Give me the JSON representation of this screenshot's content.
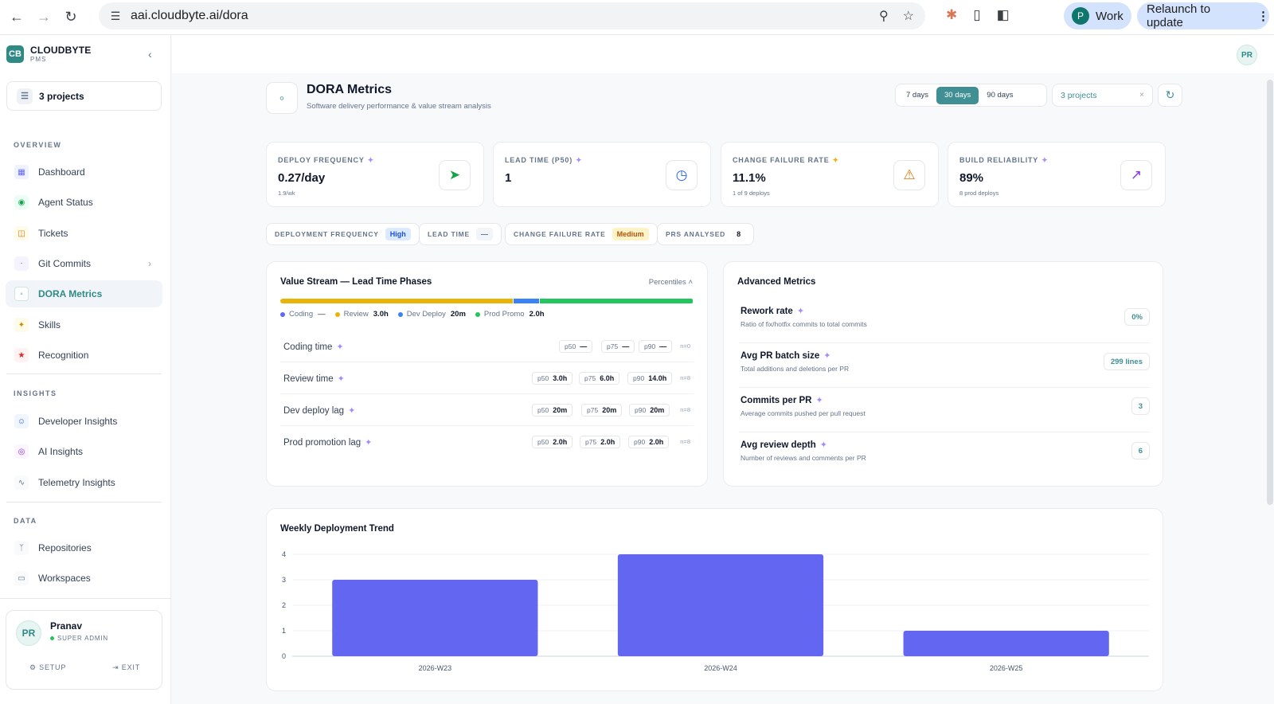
{
  "browser": {
    "url": "aai.cloudbyte.ai/dora",
    "profile_initial": "P",
    "profile_label": "Work",
    "relaunch_label": "Relaunch to update"
  },
  "sidebar": {
    "brand_name": "CLOUDBYTE",
    "brand_sub": "PMS",
    "logo_text": "CB",
    "project_selector": "3 projects",
    "sections": {
      "overview": "OVERVIEW",
      "insights": "INSIGHTS",
      "data": "DATA"
    },
    "items": [
      {
        "label": "Dashboard"
      },
      {
        "label": "Agent Status"
      },
      {
        "label": "Tickets"
      },
      {
        "label": "Git Commits"
      },
      {
        "label": "DORA Metrics"
      },
      {
        "label": "Skills"
      },
      {
        "label": "Recognition"
      },
      {
        "label": "Developer Insights"
      },
      {
        "label": "AI Insights"
      },
      {
        "label": "Telemetry Insights"
      },
      {
        "label": "Repositories"
      },
      {
        "label": "Workspaces"
      }
    ],
    "user": {
      "initials": "PR",
      "name": "Pranav",
      "role": "SUPER ADMIN",
      "setup_label": "SETUP",
      "exit_label": "EXIT"
    }
  },
  "topbar": {
    "avatar_initials": "PR"
  },
  "header": {
    "title": "DORA Metrics",
    "subtitle": "Software delivery performance & value stream analysis",
    "ranges": [
      "7 days",
      "30 days",
      "90 days"
    ],
    "selected_range": "30 days",
    "project_filter": "3 projects",
    "clear_icon": "×"
  },
  "kpis": [
    {
      "label": "DEPLOY FREQUENCY",
      "value": "0.27/day",
      "sub": "1.9/wk",
      "icon": "rocket-icon",
      "color": "#16a34a"
    },
    {
      "label": "LEAD TIME (P50)",
      "value": "1",
      "sub": "",
      "icon": "clock-icon",
      "color": "#2563eb"
    },
    {
      "label": "CHANGE FAILURE RATE",
      "value": "11.1%",
      "sub": "1 of 9 deploys",
      "icon": "warning-icon",
      "color": "#d97706"
    },
    {
      "label": "BUILD RELIABILITY",
      "value": "89%",
      "sub": "8 prod deploys",
      "icon": "trend-up-icon",
      "color": "#7c3aed"
    }
  ],
  "ratings": [
    {
      "label": "DEPLOYMENT FREQUENCY",
      "value": "High",
      "bg": "#dbeafe",
      "fg": "#1d4ed8"
    },
    {
      "label": "LEAD TIME",
      "value": "—",
      "bg": "#f1f5f9",
      "fg": "#64748b"
    },
    {
      "label": "CHANGE FAILURE RATE",
      "value": "Medium",
      "bg": "#fef3c7",
      "fg": "#b45309"
    },
    {
      "label": "PRS ANALYSED",
      "value": "8",
      "bg": "#ffffff",
      "fg": "#0f172a"
    }
  ],
  "value_stream": {
    "title": "Value Stream — Lead Time Phases",
    "percentiles_label": "Percentiles",
    "bar_shares": {
      "coding": 0,
      "review": 0.565,
      "dev_deploy": 0.063,
      "prod_promo": 0.372
    },
    "legend": [
      {
        "name": "Coding",
        "value": "—",
        "color": "#6366f1"
      },
      {
        "name": "Review",
        "value": "3.0h",
        "color": "#eab308"
      },
      {
        "name": "Dev Deploy",
        "value": "20m",
        "color": "#3b82f6"
      },
      {
        "name": "Prod Promo",
        "value": "2.0h",
        "color": "#22c55e"
      }
    ],
    "phases": [
      {
        "name": "Coding time",
        "p50": "—",
        "p75": "—",
        "p90": "—",
        "n": "n=0"
      },
      {
        "name": "Review time",
        "p50": "3.0h",
        "p75": "6.0h",
        "p90": "14.0h",
        "n": "n=8"
      },
      {
        "name": "Dev deploy lag",
        "p50": "20m",
        "p75": "20m",
        "p90": "20m",
        "n": "n=8"
      },
      {
        "name": "Prod promotion lag",
        "p50": "2.0h",
        "p75": "2.0h",
        "p90": "2.0h",
        "n": "n=8"
      }
    ],
    "pct_labels": {
      "p50": "p50",
      "p75": "p75",
      "p90": "p90"
    }
  },
  "advanced": {
    "title": "Advanced Metrics",
    "rows": [
      {
        "name": "Rework rate",
        "desc": "Ratio of fix/hotfix commits to total commits",
        "value": "0%"
      },
      {
        "name": "Avg PR batch size",
        "desc": "Total additions and deletions per PR",
        "value": "299 lines"
      },
      {
        "name": "Commits per PR",
        "desc": "Average commits pushed per pull request",
        "value": "3"
      },
      {
        "name": "Avg review depth",
        "desc": "Number of reviews and comments per PR",
        "value": "6"
      }
    ]
  },
  "chart_data": {
    "type": "bar",
    "title": "Weekly Deployment Trend",
    "categories": [
      "2026-W23",
      "2026-W24",
      "2026-W25"
    ],
    "values": [
      3,
      4,
      1
    ],
    "ylim": [
      0,
      4
    ],
    "yticks": [
      "0",
      "1",
      "2",
      "3",
      "4"
    ],
    "xlabel": "",
    "ylabel": "",
    "grid": true,
    "bar_color": "#6366f1"
  }
}
